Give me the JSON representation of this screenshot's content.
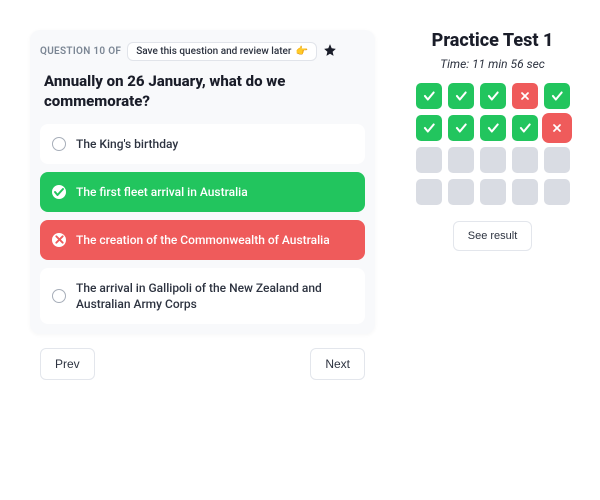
{
  "question": {
    "indicator": "QUESTION 10 OF",
    "save_label": "Save this question and review later",
    "text": "Annually on 26 January, what do we commemorate?",
    "options": [
      {
        "label": "The King's birthday",
        "state": "default"
      },
      {
        "label": "The first fleet arrival in Australia",
        "state": "correct"
      },
      {
        "label": "The creation of the Commonwealth of Australia",
        "state": "wrong"
      },
      {
        "label": "The arrival in Gallipoli of the New Zealand and Australian Army Corps",
        "state": "default"
      }
    ]
  },
  "nav": {
    "prev": "Prev",
    "next": "Next"
  },
  "sidebar": {
    "title": "Practice Test 1",
    "time_label": "Time: 11 min 56 sec",
    "see_result": "See result",
    "cells": [
      "correct",
      "correct",
      "correct",
      "wrong",
      "correct",
      "correct",
      "correct",
      "correct",
      "correct",
      "wrong-current",
      "empty",
      "empty",
      "empty",
      "empty",
      "empty",
      "empty",
      "empty",
      "empty",
      "empty",
      "empty"
    ]
  }
}
